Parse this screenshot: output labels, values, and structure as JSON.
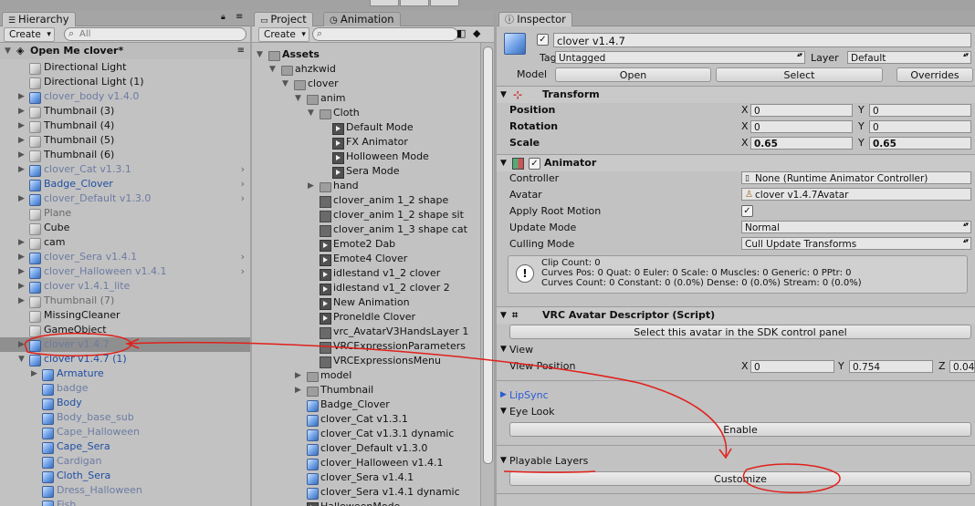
{
  "hierarchy": {
    "tab": "Hierarchy",
    "create": "Create",
    "search_placeholder": "All",
    "scene": "Open Me clover*",
    "items": [
      {
        "label": "Directional Light",
        "style": "normal",
        "icon": "cube-icon"
      },
      {
        "label": "Directional Light (1)",
        "style": "normal",
        "icon": "cube-icon"
      },
      {
        "label": "clover_body v1.4.0",
        "style": "prefab-faded",
        "icon": "prefab-icon",
        "arrow": true
      },
      {
        "label": "Thumbnail (3)",
        "style": "normal",
        "icon": "cube-icon",
        "arrow": true
      },
      {
        "label": "Thumbnail (4)",
        "style": "normal",
        "icon": "cube-icon",
        "arrow": true
      },
      {
        "label": "Thumbnail (5)",
        "style": "normal",
        "icon": "cube-icon",
        "arrow": true
      },
      {
        "label": "Thumbnail (6)",
        "style": "normal",
        "icon": "cube-icon",
        "arrow": true
      },
      {
        "label": "clover_Cat v1.3.1",
        "style": "prefab-faded",
        "icon": "prefab-icon",
        "arrow": true,
        "chev": true
      },
      {
        "label": "Badge_Clover",
        "style": "prefab-blue",
        "icon": "prefab-icon",
        "chev": true
      },
      {
        "label": "clover_Default v1.3.0",
        "style": "prefab-faded",
        "icon": "prefab-icon",
        "arrow": true,
        "chev": true
      },
      {
        "label": "Plane",
        "style": "faded",
        "icon": "cube-icon"
      },
      {
        "label": "Cube",
        "style": "normal",
        "icon": "cube-icon"
      },
      {
        "label": "cam",
        "style": "normal",
        "icon": "cube-icon",
        "arrow": true
      },
      {
        "label": "clover_Sera v1.4.1",
        "style": "prefab-faded",
        "icon": "prefab-icon",
        "arrow": true,
        "chev": true
      },
      {
        "label": "clover_Halloween v1.4.1",
        "style": "prefab-faded",
        "icon": "prefab-icon",
        "arrow": true,
        "chev": true
      },
      {
        "label": "clover v1.4.1_lite",
        "style": "prefab-faded",
        "icon": "prefab-icon",
        "arrow": true
      },
      {
        "label": "Thumbnail (7)",
        "style": "faded",
        "icon": "cube-icon",
        "arrow": true
      },
      {
        "label": "MissingCleaner",
        "style": "normal",
        "icon": "cube-icon"
      },
      {
        "label": "GameObject",
        "style": "normal",
        "icon": "cube-icon"
      },
      {
        "label": "clover v1.4.7",
        "style": "prefab-faded",
        "icon": "prefab-icon",
        "arrow": true,
        "selected": true
      },
      {
        "label": "clover v1.4.7 (1)",
        "style": "prefab-blue",
        "icon": "prefab-icon",
        "arrow": true,
        "open": true
      },
      {
        "label": "Armature",
        "style": "prefab-blue",
        "icon": "prefab-icon",
        "arrow": true,
        "indent": 1
      },
      {
        "label": "badge",
        "style": "prefab-faded",
        "icon": "prefab-icon",
        "indent": 1
      },
      {
        "label": "Body",
        "style": "prefab-blue",
        "icon": "prefab-icon",
        "indent": 1
      },
      {
        "label": "Body_base_sub",
        "style": "prefab-faded",
        "icon": "prefab-icon",
        "indent": 1
      },
      {
        "label": "Cape_Halloween",
        "style": "prefab-faded",
        "icon": "prefab-icon",
        "indent": 1
      },
      {
        "label": "Cape_Sera",
        "style": "prefab-blue",
        "icon": "prefab-icon",
        "indent": 1
      },
      {
        "label": "Cardigan",
        "style": "prefab-faded",
        "icon": "prefab-icon",
        "indent": 1
      },
      {
        "label": "Cloth_Sera",
        "style": "prefab-blue",
        "icon": "prefab-icon",
        "indent": 1
      },
      {
        "label": "Dress_Halloween",
        "style": "prefab-faded",
        "icon": "prefab-icon",
        "indent": 1
      },
      {
        "label": "Fish",
        "style": "prefab-faded",
        "icon": "prefab-icon",
        "indent": 1
      }
    ]
  },
  "project": {
    "tab": "Project",
    "tab2": "Animation",
    "create": "Create",
    "tree": [
      {
        "label": "Assets",
        "type": "folder",
        "depth": 0,
        "bold": true,
        "open": true
      },
      {
        "label": "ahzkwid",
        "type": "folder",
        "depth": 1,
        "open": true
      },
      {
        "label": "clover",
        "type": "folder",
        "depth": 2,
        "open": true
      },
      {
        "label": "anim",
        "type": "folder",
        "depth": 3,
        "open": true
      },
      {
        "label": "Cloth",
        "type": "folder",
        "depth": 4,
        "open": true
      },
      {
        "label": "Default Mode",
        "type": "anim",
        "depth": 5
      },
      {
        "label": "FX Animator",
        "type": "anim",
        "depth": 5
      },
      {
        "label": "Holloween Mode",
        "type": "anim",
        "depth": 5
      },
      {
        "label": "Sera Mode",
        "type": "anim",
        "depth": 5
      },
      {
        "label": "hand",
        "type": "folder",
        "depth": 4,
        "closed": true
      },
      {
        "label": "clover_anim 1_2 shape",
        "type": "blend",
        "depth": 4
      },
      {
        "label": "clover_anim 1_2 shape sit",
        "type": "blend",
        "depth": 4
      },
      {
        "label": "clover_anim 1_3 shape cat",
        "type": "blend",
        "depth": 4
      },
      {
        "label": "Emote2 Dab",
        "type": "anim",
        "depth": 4
      },
      {
        "label": "Emote4 Clover",
        "type": "anim",
        "depth": 4
      },
      {
        "label": "idlestand v1_2 clover",
        "type": "anim",
        "depth": 4
      },
      {
        "label": "idlestand v1_2 clover 2",
        "type": "anim",
        "depth": 4
      },
      {
        "label": "New Animation",
        "type": "anim",
        "depth": 4
      },
      {
        "label": "ProneIdle Clover",
        "type": "anim",
        "depth": 4
      },
      {
        "label": "vrc_AvatarV3HandsLayer 1",
        "type": "blend",
        "depth": 4
      },
      {
        "label": "VRCExpressionParameters",
        "type": "blend",
        "depth": 4
      },
      {
        "label": "VRCExpressionsMenu",
        "type": "blend",
        "depth": 4
      },
      {
        "label": "model",
        "type": "folder",
        "depth": 3,
        "closed": true
      },
      {
        "label": "Thumbnail",
        "type": "folder",
        "depth": 3,
        "closed": true
      },
      {
        "label": "Badge_Clover",
        "type": "prefab",
        "depth": 3
      },
      {
        "label": "clover_Cat v1.3.1",
        "type": "prefab",
        "depth": 3
      },
      {
        "label": "clover_Cat v1.3.1 dynamic",
        "type": "prefab",
        "depth": 3
      },
      {
        "label": "clover_Default v1.3.0",
        "type": "prefab",
        "depth": 3
      },
      {
        "label": "clover_Halloween v1.4.1",
        "type": "prefab",
        "depth": 3
      },
      {
        "label": "clover_Sera v1.4.1",
        "type": "prefab",
        "depth": 3
      },
      {
        "label": "clover_Sera v1.4.1 dynamic",
        "type": "prefab",
        "depth": 3
      },
      {
        "label": "HalloweenMode",
        "type": "anim",
        "depth": 3
      }
    ]
  },
  "inspector": {
    "tab": "Inspector",
    "object_name": "clover v1.4.7",
    "tag_label": "Tag",
    "tag_value": "Untagged",
    "layer_label": "Layer",
    "layer_value": "Default",
    "model_label": "Model",
    "open_btn": "Open",
    "select_btn": "Select",
    "overrides_btn": "Overrides",
    "transform": {
      "title": "Transform",
      "position": "Position",
      "pos_x": "0",
      "pos_y": "0",
      "rotation": "Rotation",
      "rot_x": "0",
      "rot_y": "0",
      "scale": "Scale",
      "scale_x": "0.65",
      "scale_y": "0.65",
      "x": "X",
      "y": "Y"
    },
    "animator": {
      "title": "Animator",
      "controller": "Controller",
      "controller_value": "None (Runtime Animator Controller)",
      "avatar": "Avatar",
      "avatar_value": "clover v1.4.7Avatar",
      "apply_root": "Apply Root Motion",
      "update_mode": "Update Mode",
      "update_value": "Normal",
      "culling_mode": "Culling Mode",
      "culling_value": "Cull Update Transforms",
      "info1": "Clip Count: 0",
      "info2": "Curves Pos: 0 Quat: 0 Euler: 0 Scale: 0 Muscles: 0 Generic: 0 PPtr: 0",
      "info3": "Curves Count: 0 Constant: 0 (0.0%) Dense: 0 (0.0%) Stream: 0 (0.0%)"
    },
    "vrc": {
      "title": "VRC Avatar Descriptor (Script)",
      "sdk_btn": "Select this avatar in the SDK control panel",
      "view": "View",
      "view_position": "View Position",
      "vp_x": "0",
      "vp_y": "0.754",
      "vp_z": "0.04",
      "z": "Z",
      "lipsync": "LipSync",
      "eye_look": "Eye Look",
      "enable_btn": "Enable",
      "playable_layers": "Playable Layers",
      "customize_btn": "Customize"
    }
  },
  "colors": {
    "annotation": "#e0201b"
  }
}
